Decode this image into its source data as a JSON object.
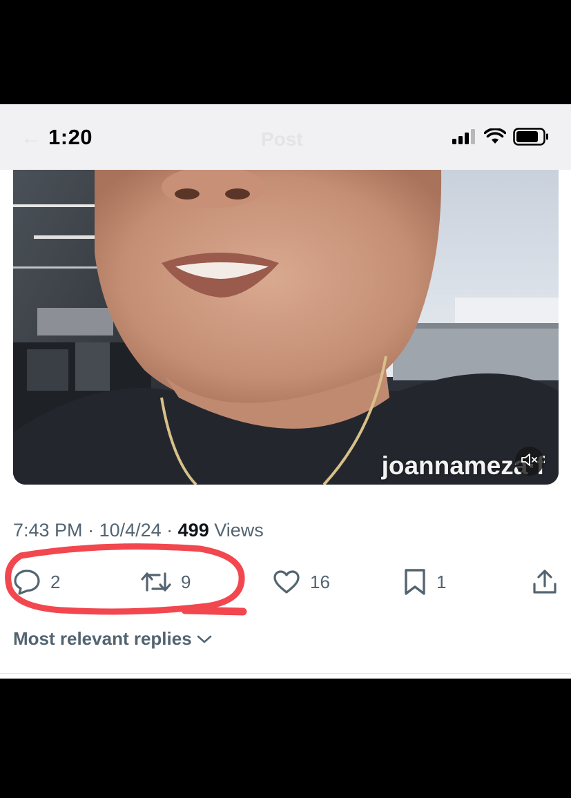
{
  "status_bar": {
    "time": "1:20"
  },
  "header": {
    "title": "Post",
    "back_icon": "arrow-left-icon"
  },
  "video": {
    "watermark": "joannameza·f",
    "mute_icon": "speaker-muted-icon"
  },
  "post_meta": {
    "time": "7:43 PM",
    "separator": " · ",
    "date": "10/4/24",
    "views_count": "499",
    "views_label": "Views"
  },
  "actions": {
    "reply_count": "2",
    "repost_count": "9",
    "like_count": "16",
    "bookmark_count": "1"
  },
  "replies": {
    "sort_label": "Most relevant replies"
  },
  "colors": {
    "text_secondary": "#536471",
    "text_primary": "#0f1419",
    "annotation_red": "#f2474e",
    "status_bar_bg": "#f1f1f3"
  }
}
